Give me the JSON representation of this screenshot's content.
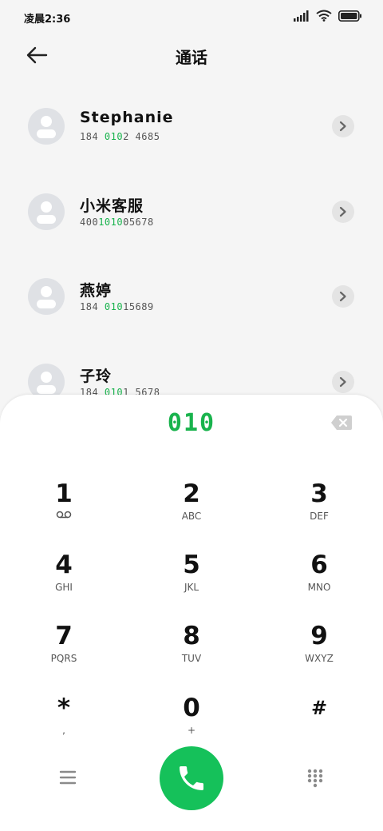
{
  "status_bar": {
    "time": "凌晨2:36"
  },
  "header": {
    "title": "通话"
  },
  "contacts": [
    {
      "name": "Stephanie",
      "num_pre": "184 ",
      "num_hl": "010",
      "num_post": "2 4685"
    },
    {
      "name": "小米客服",
      "num_pre": "400",
      "num_hl": "1010",
      "num_post": "05678"
    },
    {
      "name": "燕婷",
      "num_pre": "184 ",
      "num_hl": "010",
      "num_post": "15689"
    },
    {
      "name": "子玲",
      "num_pre": "184 ",
      "num_hl": "010",
      "num_post": "1 5678"
    }
  ],
  "dialpad": {
    "input": "010",
    "keys": [
      {
        "digit": "1",
        "letters": ""
      },
      {
        "digit": "2",
        "letters": "ABC"
      },
      {
        "digit": "3",
        "letters": "DEF"
      },
      {
        "digit": "4",
        "letters": "GHI"
      },
      {
        "digit": "5",
        "letters": "JKL"
      },
      {
        "digit": "6",
        "letters": "MNO"
      },
      {
        "digit": "7",
        "letters": "PQRS"
      },
      {
        "digit": "8",
        "letters": "TUV"
      },
      {
        "digit": "9",
        "letters": "WXYZ"
      },
      {
        "digit": "*",
        "letters": ","
      },
      {
        "digit": "0",
        "letters": "+"
      },
      {
        "digit": "#",
        "letters": ""
      }
    ]
  },
  "icons": {
    "voicemail": "voicemail-icon",
    "back": "back-arrow-icon",
    "backspace": "backspace-icon",
    "menu": "menu-icon",
    "call": "phone-icon",
    "dialpad": "dialpad-grid-icon"
  },
  "colors": {
    "accent": "#19b34d",
    "call_button": "#15c15a"
  }
}
